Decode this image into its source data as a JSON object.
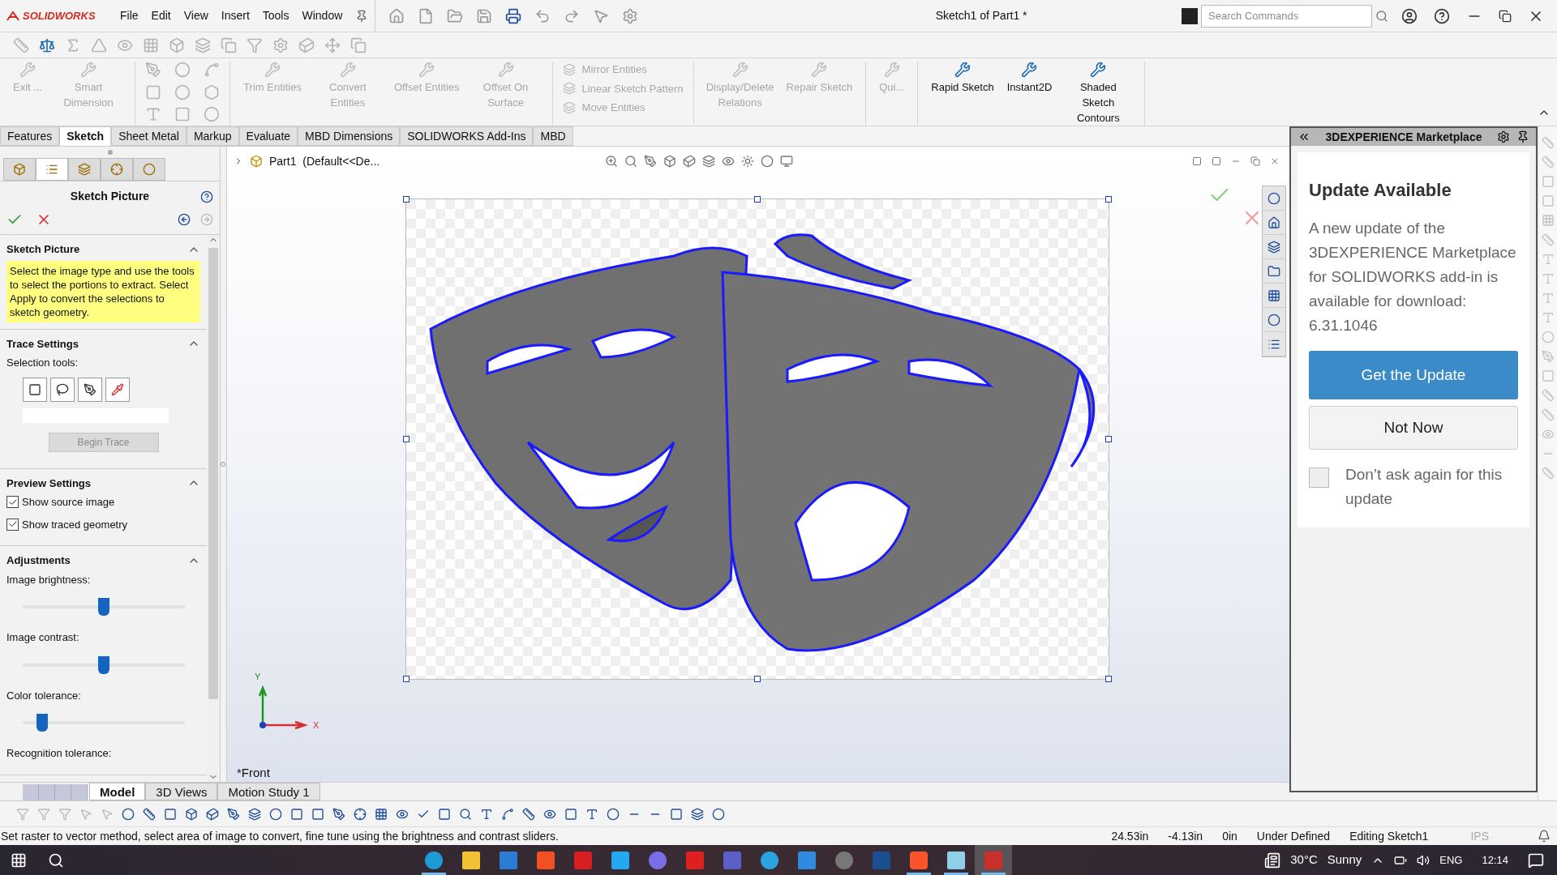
{
  "app": {
    "logo": "SOLIDWORKS",
    "menus": [
      "File",
      "Edit",
      "View",
      "Insert",
      "Tools",
      "Window"
    ],
    "title": "Sketch1 of Part1 *",
    "search": {
      "placeholder": "Search Commands"
    }
  },
  "command_groups": [
    {
      "kind": "buttons",
      "items": [
        {
          "label": "Exit ...",
          "disabled": true
        },
        {
          "label": "Smart Dimension",
          "disabled": true
        }
      ]
    },
    {
      "kind": "entity-grid"
    },
    {
      "kind": "buttons",
      "items": [
        {
          "label": "Trim Entities",
          "disabled": true
        },
        {
          "label": "Convert Entities",
          "disabled": true
        },
        {
          "label": "Offset Entities",
          "disabled": true
        },
        {
          "label": "Offset On Surface",
          "disabled": true
        }
      ]
    },
    {
      "kind": "stack",
      "items": [
        {
          "label": "Mirror Entities",
          "disabled": true
        },
        {
          "label": "Linear Sketch Pattern",
          "disabled": true
        },
        {
          "label": "Move Entities",
          "disabled": true
        }
      ]
    },
    {
      "kind": "buttons",
      "items": [
        {
          "label": "Display/Delete Relations",
          "disabled": true
        },
        {
          "label": "Repair Sketch",
          "disabled": true
        }
      ]
    },
    {
      "kind": "buttons",
      "items": [
        {
          "label": "Qui...",
          "disabled": true
        }
      ]
    },
    {
      "kind": "buttons",
      "items": [
        {
          "label": "Rapid Sketch",
          "disabled": false
        },
        {
          "label": "Instant2D",
          "disabled": false
        },
        {
          "label": "Shaded Sketch Contours",
          "disabled": false
        }
      ]
    }
  ],
  "tabs": [
    {
      "label": "Features",
      "selected": false
    },
    {
      "label": "Sketch",
      "selected": true
    },
    {
      "label": "Sheet Metal",
      "selected": false
    },
    {
      "label": "Markup",
      "selected": false
    },
    {
      "label": "Evaluate",
      "selected": false
    },
    {
      "label": "MBD Dimensions",
      "selected": false
    },
    {
      "label": "SOLIDWORKS Add-Ins",
      "selected": false
    },
    {
      "label": "MBD",
      "selected": false
    }
  ],
  "property_manager": {
    "title": "Sketch Picture",
    "panel_tabs": [
      {
        "selected": false
      },
      {
        "selected": true
      },
      {
        "selected": false
      },
      {
        "selected": false
      },
      {
        "selected": false
      }
    ],
    "sections": [
      {
        "title": "Sketch Picture",
        "expanded": true,
        "items": [
          {
            "kind": "note",
            "text": "Select the image type and use the tools to select the portions to extract. Select Apply to convert the selections to sketch geometry."
          }
        ]
      },
      {
        "title": "Trace Settings",
        "expanded": true,
        "items": [
          {
            "kind": "label",
            "text": "Selection tools:"
          },
          {
            "kind": "tools"
          },
          {
            "kind": "field"
          },
          {
            "kind": "button",
            "text": "Begin Trace",
            "disabled": true
          }
        ]
      },
      {
        "title": "Preview Settings",
        "expanded": true,
        "items": [
          {
            "kind": "checkbox",
            "text": "Show source image",
            "checked": true
          },
          {
            "kind": "checkbox",
            "text": "Show traced geometry",
            "checked": true
          }
        ]
      },
      {
        "title": "Adjustments",
        "expanded": true,
        "items": [
          {
            "kind": "slider",
            "text": "Image brightness:",
            "level": 0.5
          },
          {
            "kind": "slider",
            "text": "Image contrast:",
            "level": 0.5
          },
          {
            "kind": "slider",
            "text": "Color tolerance:",
            "level": 0.09
          },
          {
            "kind": "label",
            "text": "Recognition tolerance:"
          }
        ]
      }
    ]
  },
  "viewport": {
    "tree_label": "Part1  (Default<<De...",
    "view_label": "*Front",
    "triad": {
      "x": "X",
      "y": "Y"
    }
  },
  "task_pane": {
    "title": "3DEXPERIENCE Marketplace",
    "heading": "Update Available",
    "body": "A new update of the 3DEXPERIENCE Marketplace for SOLIDWORKS add-in is available for download: 6.31.1046",
    "primary_button": "Get the Update",
    "secondary_button": "Not Now",
    "dont_ask": {
      "label": "Don’t ask again for this update",
      "checked": false
    }
  },
  "bottom_tabs": [
    {
      "label": "Model",
      "selected": true
    },
    {
      "label": "3D Views",
      "selected": false
    },
    {
      "label": "Motion Study 1",
      "selected": false
    }
  ],
  "status_bar": {
    "message": "Set raster to vector method, select area of image to convert, fine tune using the brightness and contrast sliders.",
    "fields": [
      "24.53in",
      "-4.13in",
      "0in",
      "Under Defined",
      "Editing Sketch1",
      "IPS"
    ]
  },
  "taskbar": {
    "apps": [
      {
        "kind": "edge",
        "running": true,
        "selected": false
      },
      {
        "kind": "explorer",
        "running": false,
        "selected": false
      },
      {
        "kind": "mail",
        "running": false,
        "selected": false
      },
      {
        "kind": "store",
        "running": false,
        "selected": false
      },
      {
        "kind": "gift",
        "running": false,
        "selected": false
      },
      {
        "kind": "vscode",
        "running": false,
        "selected": false
      },
      {
        "kind": "copilot",
        "running": false,
        "selected": false
      },
      {
        "kind": "acrobat",
        "running": false,
        "selected": false
      },
      {
        "kind": "teams",
        "running": false,
        "selected": false
      },
      {
        "kind": "telegram",
        "running": false,
        "selected": false
      },
      {
        "kind": "widgets",
        "running": false,
        "selected": false
      },
      {
        "kind": "camera",
        "running": false,
        "selected": false
      },
      {
        "kind": "prime",
        "running": false,
        "selected": false
      },
      {
        "kind": "brave",
        "running": true,
        "selected": false
      },
      {
        "kind": "notepad",
        "running": true,
        "selected": false
      },
      {
        "kind": "solidworks",
        "running": true,
        "selected": true
      }
    ],
    "temperature": "30°C",
    "weather": "Sunny",
    "language": "ENG",
    "time": "12:14"
  }
}
